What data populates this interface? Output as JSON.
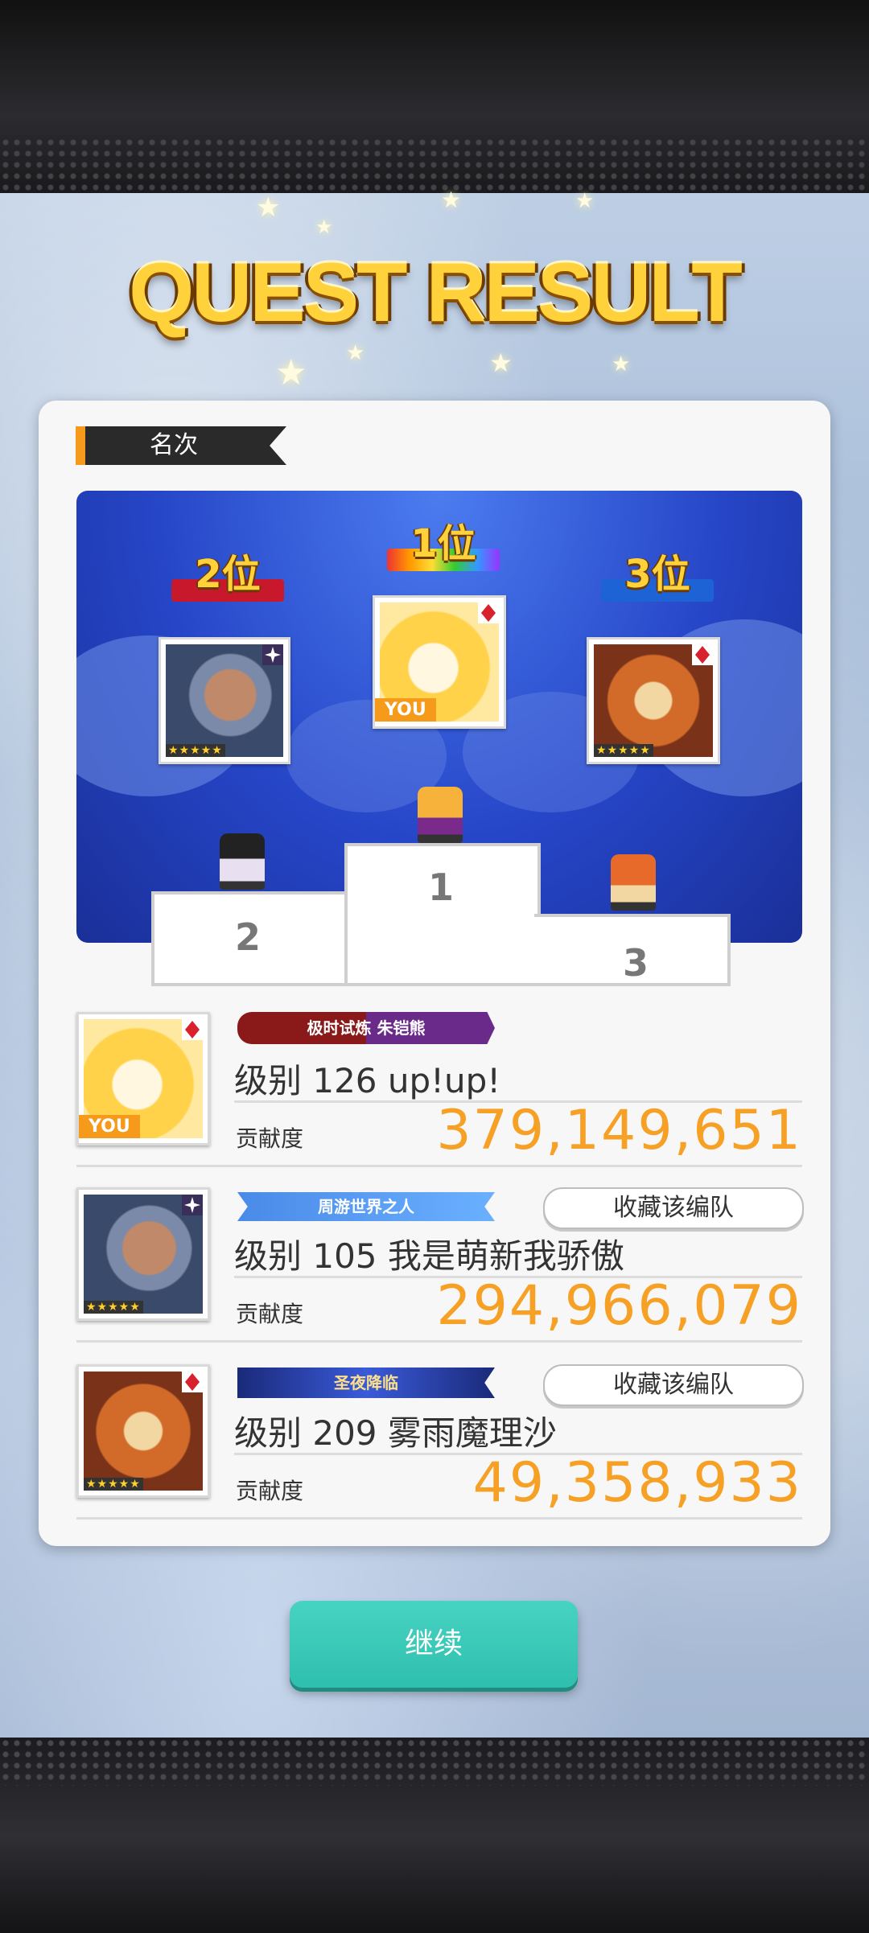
{
  "title": "QUEST RESULT",
  "section": {
    "label": "名次"
  },
  "podium": {
    "ranks": [
      {
        "label": "1位",
        "step": "1"
      },
      {
        "label": "2位",
        "step": "2"
      },
      {
        "label": "3位",
        "step": "3"
      }
    ],
    "you_tag": "YOU"
  },
  "results": [
    {
      "rank": 1,
      "you_tag": "YOU",
      "badge": "极时试炼  朱铠熊",
      "player": "级别 126 up!up!",
      "contrib_label": "贡献度",
      "contrib_value": "379,149,651",
      "show_fav": false
    },
    {
      "rank": 2,
      "badge": "周游世界之人",
      "fav_label": "收藏该编队",
      "player": "级别 105 我是萌新我骄傲",
      "contrib_label": "贡献度",
      "contrib_value": "294,966,079",
      "show_fav": true
    },
    {
      "rank": 3,
      "badge": "圣夜降临",
      "fav_label": "收藏该编队",
      "player": "级别 209 雾雨魔理沙",
      "contrib_label": "贡献度",
      "contrib_value": "49,358,933",
      "show_fav": true
    }
  ],
  "continue_label": "继续",
  "colors": {
    "accent": "#f6a126",
    "button": "#2fbfae",
    "gold": "#ffd23b"
  }
}
